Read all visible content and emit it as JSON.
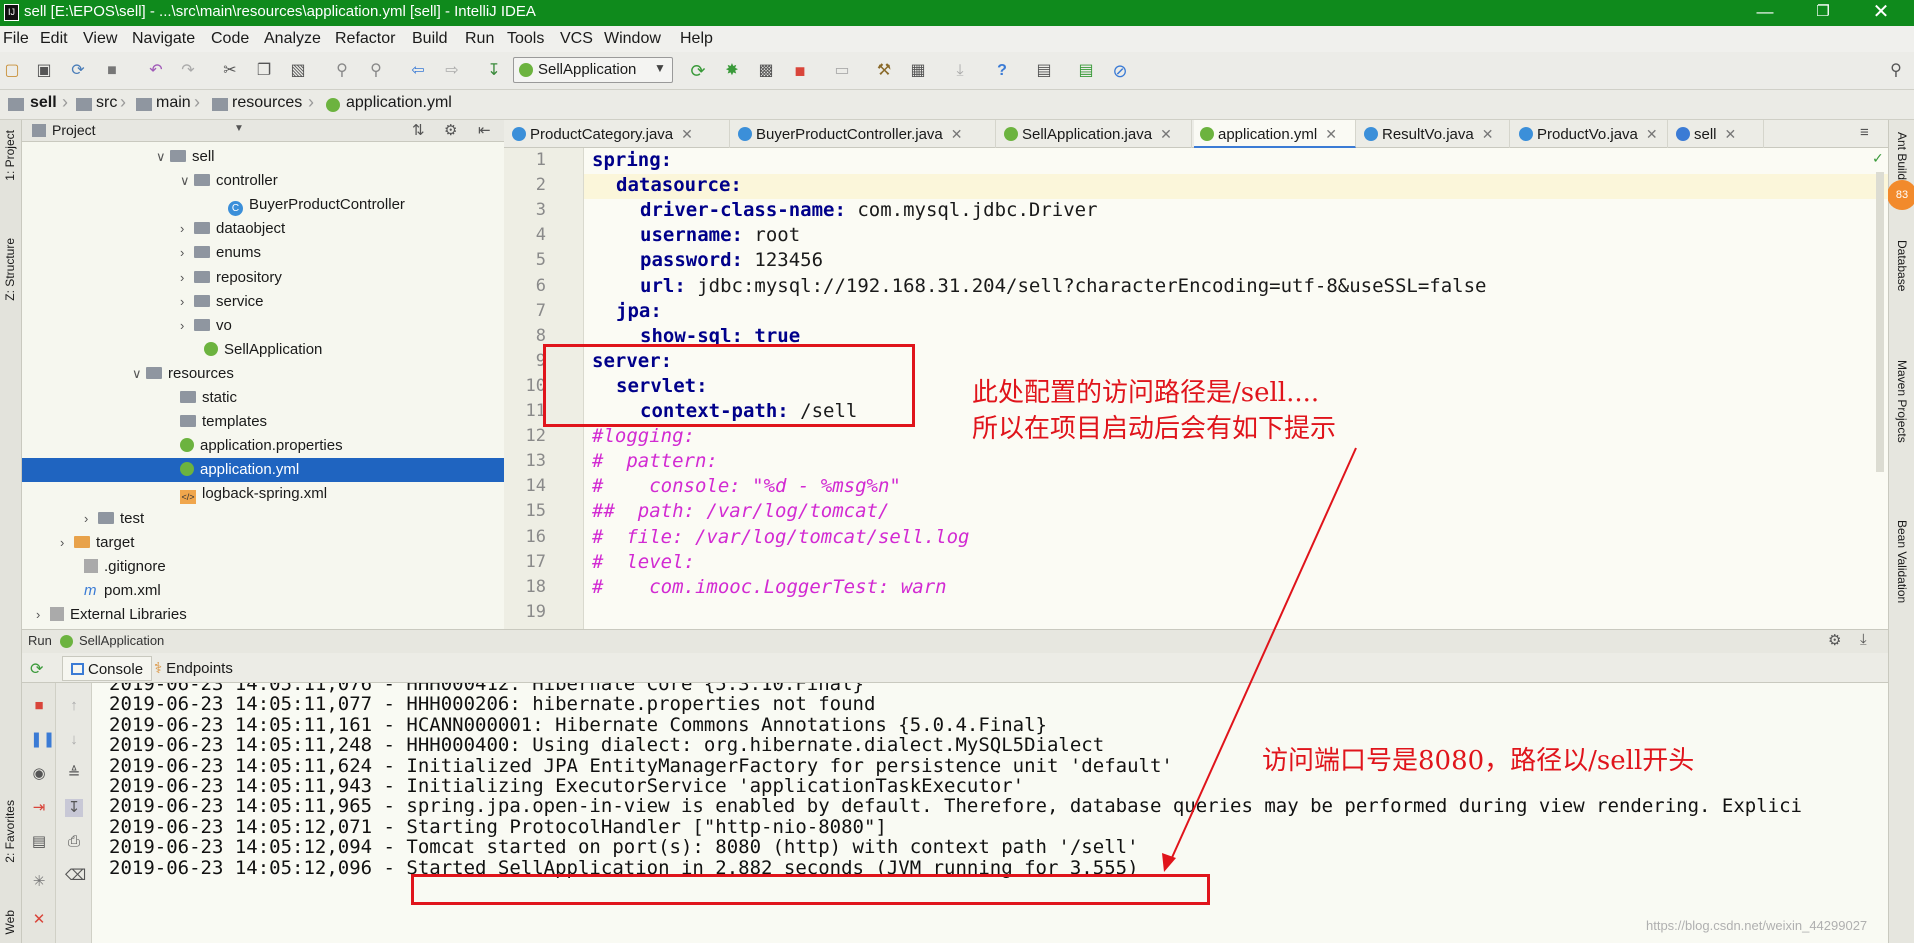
{
  "window": {
    "title": "sell [E:\\EPOS\\sell] - ...\\src\\main\\resources\\application.yml [sell] - IntelliJ IDEA",
    "logo": "IJ",
    "colors": {
      "titlebar": "#0f8a1c",
      "selection": "#1f64c0",
      "annotation": "#e0141b",
      "keyword": "#00008a",
      "comment": "#d22ad2"
    }
  },
  "menu": [
    "File",
    "Edit",
    "View",
    "Navigate",
    "Code",
    "Analyze",
    "Refactor",
    "Build",
    "Run",
    "Tools",
    "VCS",
    "Window",
    "Help"
  ],
  "toolbar": {
    "run_config": "SellApplication"
  },
  "breadcrumb": [
    "sell",
    "src",
    "main",
    "resources",
    "application.yml"
  ],
  "left_tools": {
    "project": "1: Project",
    "structure": "Z: Structure",
    "favorites": "2: Favorites",
    "web": "Web"
  },
  "right_tools": {
    "ant": "Ant Build",
    "database": "Database",
    "maven": "Maven Projects",
    "bean": "Bean Validation",
    "badge": "83"
  },
  "project": {
    "header": "Project",
    "tree": [
      {
        "label": "sell",
        "kind": "folder",
        "level": 0,
        "arrow": "v"
      },
      {
        "label": "controller",
        "kind": "folder",
        "level": 1,
        "arrow": "v"
      },
      {
        "label": "BuyerProductController",
        "kind": "class",
        "level": 2,
        "arrow": ""
      },
      {
        "label": "dataobject",
        "kind": "folder",
        "level": 1,
        "arrow": ">"
      },
      {
        "label": "enums",
        "kind": "folder",
        "level": 1,
        "arrow": ">"
      },
      {
        "label": "repository",
        "kind": "folder",
        "level": 1,
        "arrow": ">"
      },
      {
        "label": "service",
        "kind": "folder",
        "level": 1,
        "arrow": ">"
      },
      {
        "label": "vo",
        "kind": "folder",
        "level": 1,
        "arrow": ">"
      },
      {
        "label": "SellApplication",
        "kind": "app",
        "level": 1,
        "arrow": ""
      },
      {
        "label": "resources",
        "kind": "folder",
        "level": -1,
        "arrow": "v"
      },
      {
        "label": "static",
        "kind": "folder",
        "level": 0,
        "arrow": ""
      },
      {
        "label": "templates",
        "kind": "folder",
        "level": 0,
        "arrow": ""
      },
      {
        "label": "application.properties",
        "kind": "leaf",
        "level": 0,
        "arrow": ""
      },
      {
        "label": "application.yml",
        "kind": "leaf",
        "level": 0,
        "arrow": "",
        "selected": true
      },
      {
        "label": "logback-spring.xml",
        "kind": "xml",
        "level": 0,
        "arrow": ""
      },
      {
        "label": "test",
        "kind": "folder",
        "level": -3,
        "arrow": ">"
      },
      {
        "label": "target",
        "kind": "orange",
        "level": -4,
        "arrow": ">"
      },
      {
        "label": ".gitignore",
        "kind": "git",
        "level": -4,
        "arrow": ""
      },
      {
        "label": "pom.xml",
        "kind": "maven",
        "level": -4,
        "arrow": ""
      },
      {
        "label": "External Libraries",
        "kind": "lib",
        "level": -5,
        "arrow": ">"
      }
    ]
  },
  "tabs": [
    {
      "label": "ProductCategory.java"
    },
    {
      "label": "BuyerProductController.java"
    },
    {
      "label": "SellApplication.java"
    },
    {
      "label": "application.yml",
      "active": true
    },
    {
      "label": "ResultVo.java"
    },
    {
      "label": "ProductVo.java"
    },
    {
      "label": "sell"
    }
  ],
  "editor": {
    "line_numbers": [
      "1",
      "2",
      "3",
      "4",
      "5",
      "6",
      "7",
      "8",
      "9",
      "10",
      "11",
      "12",
      "13",
      "14",
      "15",
      "16",
      "17",
      "18",
      "19"
    ],
    "lines": [
      {
        "key": "spring:",
        "val": "",
        "indent": 0,
        "type": "kv"
      },
      {
        "key": "datasource:",
        "val": "",
        "indent": 1,
        "type": "kv"
      },
      {
        "key": "driver-class-name:",
        "val": " com.mysql.jdbc.Driver",
        "indent": 2,
        "type": "kv"
      },
      {
        "key": "username:",
        "val": " root",
        "indent": 2,
        "type": "kv"
      },
      {
        "key": "password:",
        "val": " 123456",
        "indent": 2,
        "type": "kv"
      },
      {
        "key": "url:",
        "val": " jdbc:mysql://192.168.31.204/sell?characterEncoding=utf-8&useSSL=false",
        "indent": 2,
        "type": "kv"
      },
      {
        "key": "jpa:",
        "val": "",
        "indent": 1,
        "type": "kv"
      },
      {
        "key": "show-sql:",
        "val": " true",
        "indent": 2,
        "type": "kvb"
      },
      {
        "key": "server:",
        "val": "",
        "indent": 0,
        "type": "kv"
      },
      {
        "key": "servlet:",
        "val": "",
        "indent": 1,
        "type": "kv"
      },
      {
        "key": "context-path:",
        "val": " /sell",
        "indent": 2,
        "type": "kv"
      },
      {
        "comment": "#logging:",
        "type": "c"
      },
      {
        "comment": "#  pattern:",
        "type": "c"
      },
      {
        "comment": "#    console: \"%d - %msg%n\"",
        "type": "c"
      },
      {
        "comment": "##  path: /var/log/tomcat/",
        "type": "c"
      },
      {
        "comment": "#  file: /var/log/tomcat/sell.log",
        "type": "c"
      },
      {
        "comment": "#  level:",
        "type": "c"
      },
      {
        "comment": "#    com.imooc.LoggerTest: warn",
        "type": "c"
      },
      {
        "comment": "",
        "type": "c"
      }
    ]
  },
  "run": {
    "label": "Run",
    "config": "SellApplication",
    "tabs": [
      "Console",
      "Endpoints"
    ],
    "log": [
      "2019-06-23 14:05:11,076 - HHH000412: Hibernate Core {5.3.10.Final}",
      "2019-06-23 14:05:11,077 - HHH000206: hibernate.properties not found",
      "2019-06-23 14:05:11,161 - HCANN000001: Hibernate Commons Annotations {5.0.4.Final}",
      "2019-06-23 14:05:11,248 - HHH000400: Using dialect: org.hibernate.dialect.MySQL5Dialect",
      "2019-06-23 14:05:11,624 - Initialized JPA EntityManagerFactory for persistence unit 'default'",
      "2019-06-23 14:05:11,943 - Initializing ExecutorService 'applicationTaskExecutor'",
      "2019-06-23 14:05:11,965 - spring.jpa.open-in-view is enabled by default. Therefore, database queries may be performed during view rendering. Explici",
      "2019-06-23 14:05:12,071 - Starting ProtocolHandler [\"http-nio-8080\"]",
      "2019-06-23 14:05:12,094 - Tomcat started on port(s): 8080 (http) with context path '/sell'",
      "2019-06-23 14:05:12,096 - Started SellApplication in 2.882 seconds (JVM running for 3.555)"
    ]
  },
  "annotations": {
    "note1_line1": "此处配置的访问路径是/sell....",
    "note1_line2": "所以在项目启动后会有如下提示",
    "note2": "访问端口号是8080，路径以/sell开头",
    "watermark": "https://blog.csdn.net/weixin_44299027"
  }
}
